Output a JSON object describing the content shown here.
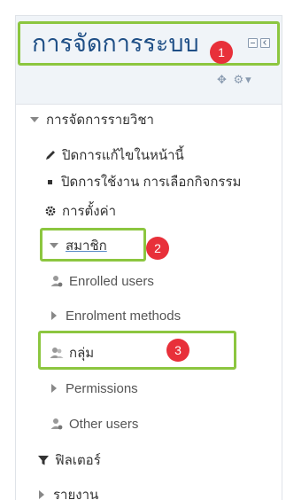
{
  "block": {
    "title": "การจัดการระบบ",
    "dock_icons": [
      "minimize-icon",
      "dock-icon"
    ],
    "action_icons": [
      "move-icon",
      "gear-icon"
    ]
  },
  "tree": {
    "course_admin": "การจัดการรายวิชา",
    "turn_editing_off": "ปิดการแก้ไขในหน้านี้",
    "disable_activity_chooser": "ปิดการใช้งาน การเลือกกิจกรรม",
    "settings": "การตั้งค่า",
    "users": "สมาชิก",
    "enrolled_users": "Enrolled users",
    "enrolment_methods": "Enrolment methods",
    "groups": "กลุ่ม",
    "permissions": "Permissions",
    "other_users": "Other users",
    "filters": "ฟิลเตอร์",
    "reports": "รายงาน"
  },
  "annotations": {
    "badge_1": "1",
    "badge_2": "2",
    "badge_3": "3",
    "highlight_color": "#8cc63f",
    "badge_color": "#e8303a"
  },
  "colors": {
    "title": "#1f4f86",
    "header_bg": "#f0f4f8"
  }
}
